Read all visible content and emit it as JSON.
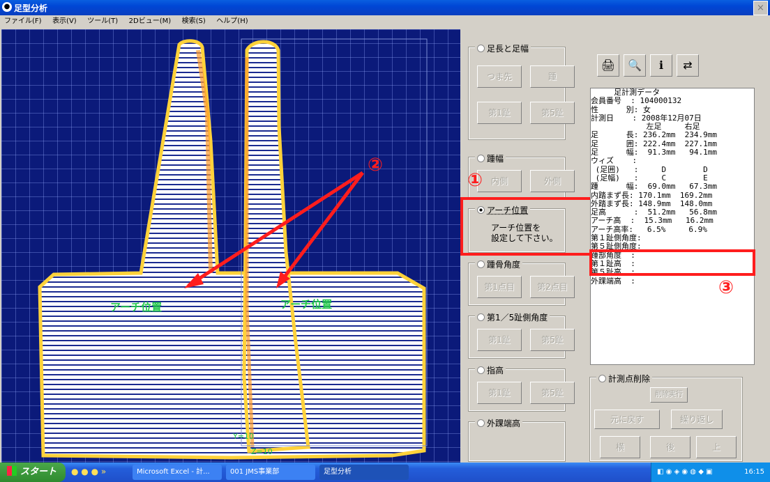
{
  "window": {
    "title": "足型分析",
    "close_glyph": "×"
  },
  "menu": [
    "ファイル(F)",
    "表示(V)",
    "ツール(T)",
    "2Dビュー(M)",
    "検索(S)",
    "ヘルプ(H)"
  ],
  "viewport": {
    "arch_label_left": "アーチ位置",
    "arch_label_right": "アーチ位置",
    "axis_y": "Y=10",
    "axis_z": "Z=10",
    "marker_2": "②",
    "marker_1": "①",
    "marker_3": "③",
    "arrow_color": "#ff1d1d",
    "label_color": "#22c84a"
  },
  "panel": {
    "group_length": {
      "title": "足長と足幅",
      "buttons": [
        "つま先",
        "踵",
        "第1趾",
        "第5趾"
      ]
    },
    "group_heel": {
      "title": "踵幅",
      "buttons": [
        "内側",
        "外側"
      ]
    },
    "group_arch": {
      "title": "アーチ位置",
      "hint_line1": "アーチ位置を",
      "hint_line2": "設定して下さい。"
    },
    "group_heel_angle": {
      "title": "踵骨角度",
      "buttons": [
        "第1点目",
        "第2点目"
      ]
    },
    "group_toe_angle": {
      "title": "第1／5趾側角度",
      "buttons": [
        "第1趾",
        "第5趾"
      ]
    },
    "group_toe_height": {
      "title": "指高",
      "buttons": [
        "第1趾",
        "第5趾"
      ]
    },
    "group_ankle": {
      "title": "外踝端高"
    },
    "group_delete": {
      "title": "計測点削除",
      "buttons": [
        "削除実行",
        "元に戻す",
        "繰り返し",
        "横",
        "後",
        "上"
      ]
    },
    "tools": [
      "printer-icon",
      "preview-icon",
      "info-icon",
      "export-icon"
    ]
  },
  "measure": {
    "rows": [
      "     足計測データ",
      "会員番号  : 104000132",
      "性      別: 女",
      "計測日    : 2008年12月07日",
      "            左足     右足",
      "足      長: 236.2mm  234.9mm",
      "足      囲: 222.4mm  227.1mm",
      "足      幅:  91.3mm   94.1mm",
      "ウィズ    :",
      " (足囲)   :     D        D",
      " (足幅)   :     C        E",
      "踵      幅:  69.0mm   67.3mm",
      "内踏まず長: 170.1mm  169.2mm",
      "外踏まず長: 148.9mm  148.0mm",
      "足高      :  51.2mm   56.8mm",
      "アーチ高  :  15.3mm   16.2mm",
      "アーチ高率:   6.5%     6.9%",
      "第１趾側角度:",
      "第５趾側角度:",
      "踵部角度  :",
      "",
      "第１趾高  :",
      "第５趾高  :",
      "外踝端高  :"
    ]
  },
  "taskbar": {
    "start": "スタート",
    "quick_launch": "» ",
    "tasks": [
      "Microsoft Excel - 計...",
      "001 JMS事業部",
      "足型分析"
    ],
    "clock": "16:15"
  }
}
